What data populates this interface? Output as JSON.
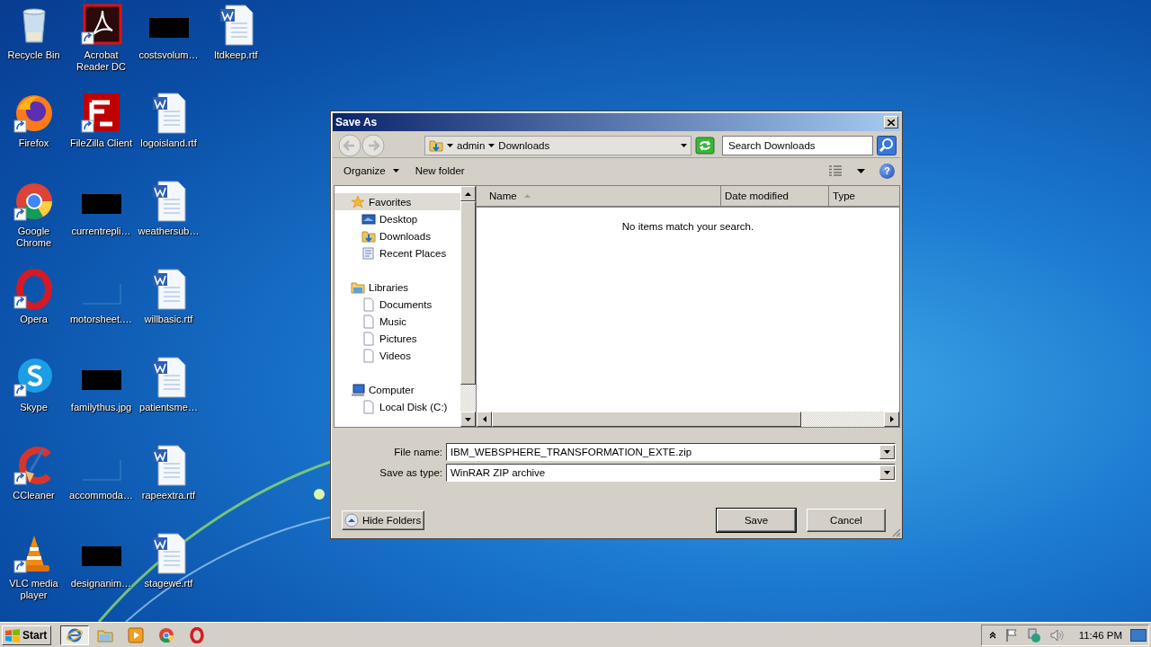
{
  "desktop_icons": [
    {
      "label": "Recycle Bin",
      "kind": "recycle",
      "shortcut": false
    },
    {
      "label": "Firefox",
      "kind": "firefox",
      "shortcut": true
    },
    {
      "label": "Google Chrome",
      "kind": "chrome",
      "shortcut": true
    },
    {
      "label": "Opera",
      "kind": "opera",
      "shortcut": true
    },
    {
      "label": "Skype",
      "kind": "skype",
      "shortcut": true
    },
    {
      "label": "CCleaner",
      "kind": "ccleaner",
      "shortcut": true
    },
    {
      "label": "VLC media player",
      "kind": "vlc",
      "shortcut": true
    },
    {
      "label": "Acrobat Reader DC",
      "kind": "acrobat",
      "shortcut": true
    },
    {
      "label": "FileZilla Client",
      "kind": "filezilla",
      "shortcut": true
    },
    {
      "label": "currentrepli…",
      "kind": "dark-thumb",
      "shortcut": false
    },
    {
      "label": "motorsheet.…",
      "kind": "blank-thumb",
      "shortcut": false
    },
    {
      "label": "familythus.jpg",
      "kind": "dark-thumb",
      "shortcut": false
    },
    {
      "label": "accommoda…",
      "kind": "blank-thumb",
      "shortcut": false
    },
    {
      "label": "designanim…",
      "kind": "dark-thumb",
      "shortcut": false
    },
    {
      "label": "costsvolum…",
      "kind": "dark-thumb",
      "shortcut": false
    },
    {
      "label": "logoisland.rtf",
      "kind": "word",
      "shortcut": false
    },
    {
      "label": "weathersub…",
      "kind": "word",
      "shortcut": false
    },
    {
      "label": "willbasic.rtf",
      "kind": "word",
      "shortcut": false
    },
    {
      "label": "patientsme…",
      "kind": "word",
      "shortcut": false
    },
    {
      "label": "rapeextra.rtf",
      "kind": "word",
      "shortcut": false
    },
    {
      "label": "stagewe.rtf",
      "kind": "word",
      "shortcut": false
    },
    {
      "label": "ltdkeep.rtf",
      "kind": "word",
      "shortcut": false
    }
  ],
  "dialog": {
    "title": "Save As",
    "breadcrumb": [
      "admin",
      "Downloads"
    ],
    "search": {
      "placeholder": "Search Downloads"
    },
    "toolbar": [
      {
        "label": "Organize",
        "dropdown": true
      },
      {
        "label": "New folder",
        "dropdown": false
      }
    ],
    "help": "?",
    "nav": [
      {
        "label": "Favorites",
        "kind": "star",
        "selected": true,
        "children": [
          {
            "label": "Desktop",
            "kind": "desktop",
            "selected": false
          },
          {
            "label": "Downloads",
            "kind": "downloads",
            "selected": false
          },
          {
            "label": "Recent Places",
            "kind": "recent",
            "selected": false
          }
        ]
      },
      {
        "label": "Libraries",
        "kind": "libraries",
        "selected": false,
        "children": [
          {
            "label": "Documents",
            "kind": "page",
            "selected": false
          },
          {
            "label": "Music",
            "kind": "page",
            "selected": false
          },
          {
            "label": "Pictures",
            "kind": "page",
            "selected": false
          },
          {
            "label": "Videos",
            "kind": "page",
            "selected": false
          }
        ]
      },
      {
        "label": "Computer",
        "kind": "computer",
        "selected": false,
        "children": [
          {
            "label": "Local Disk (C:)",
            "kind": "page",
            "selected": false
          }
        ]
      }
    ],
    "columns": [
      {
        "label": "Name",
        "sorted": true
      },
      {
        "label": "Date modified",
        "sorted": false
      },
      {
        "label": "Type",
        "sorted": false
      }
    ],
    "empty_message": "No items match your search.",
    "fields": [
      {
        "label": "File name:",
        "value": "IBM_WEBSPHERE_TRANSFORMATION_EXTE.zip"
      },
      {
        "label": "Save as type:",
        "value": "WinRAR ZIP archive"
      }
    ],
    "hide_folders": "Hide Folders",
    "buttons": [
      {
        "label": "Save",
        "default": true
      },
      {
        "label": "Cancel",
        "default": false
      }
    ]
  },
  "taskbar": {
    "start": "Start",
    "apps": [
      {
        "kind": "ie",
        "active": true
      },
      {
        "kind": "explorer",
        "active": false
      },
      {
        "kind": "media",
        "active": false
      },
      {
        "kind": "chrome",
        "active": false
      },
      {
        "kind": "opera",
        "active": false
      }
    ],
    "clock": "11:46 PM"
  }
}
